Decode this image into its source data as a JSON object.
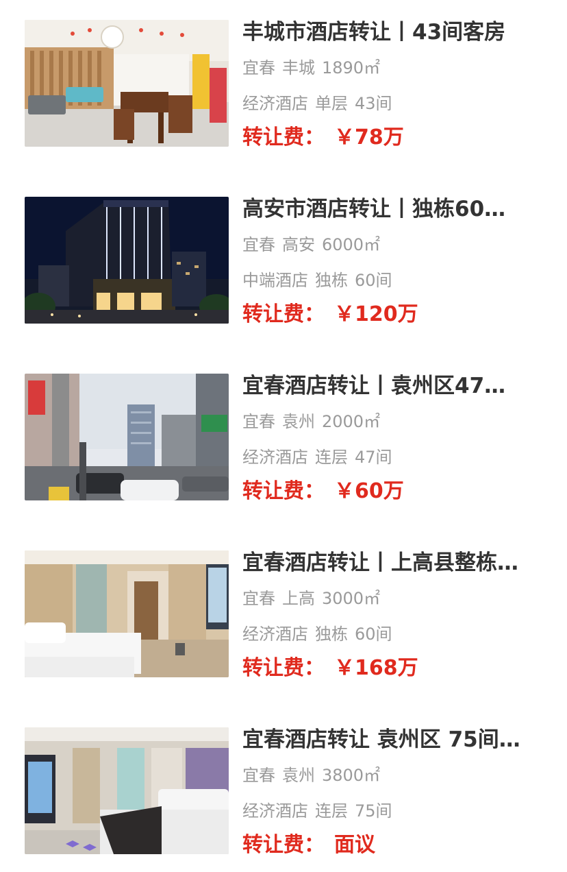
{
  "listings": [
    {
      "title": "丰城市酒店转让丨43间客房",
      "city": "宜春",
      "district": "丰城",
      "area": "1890㎡",
      "hotel_type": "经济酒店",
      "floor": "单层",
      "rooms": "43间",
      "price_label": "转让费：",
      "price": "￥78万",
      "image": "hotel-lobby-photo"
    },
    {
      "title": "高安市酒店转让丨独栋60…",
      "city": "宜春",
      "district": "高安",
      "area": "6000㎡",
      "hotel_type": "中端酒店",
      "floor": "独栋",
      "rooms": "60间",
      "price_label": "转让费：",
      "price": "￥120万",
      "image": "hotel-building-night-photo"
    },
    {
      "title": "宜春酒店转让丨袁州区47…",
      "city": "宜春",
      "district": "袁州",
      "area": "2000㎡",
      "hotel_type": "经济酒店",
      "floor": "连层",
      "rooms": "47间",
      "price_label": "转让费：",
      "price": "￥60万",
      "image": "street-view-photo"
    },
    {
      "title": "宜春酒店转让丨上高县整栋…",
      "city": "宜春",
      "district": "上高",
      "area": "3000㎡",
      "hotel_type": "经济酒店",
      "floor": "独栋",
      "rooms": "60间",
      "price_label": "转让费：",
      "price": "￥168万",
      "image": "twin-room-photo"
    },
    {
      "title": "宜春酒店转让 袁州区 75间…",
      "city": "宜春",
      "district": "袁州",
      "area": "3800㎡",
      "hotel_type": "经济酒店",
      "floor": "连层",
      "rooms": "75间",
      "price_label": "转让费：",
      "price": "面议",
      "image": "guest-room-photo"
    }
  ],
  "colors": {
    "title": "#333333",
    "meta": "#9a9a9a",
    "price": "#e02a1e"
  }
}
